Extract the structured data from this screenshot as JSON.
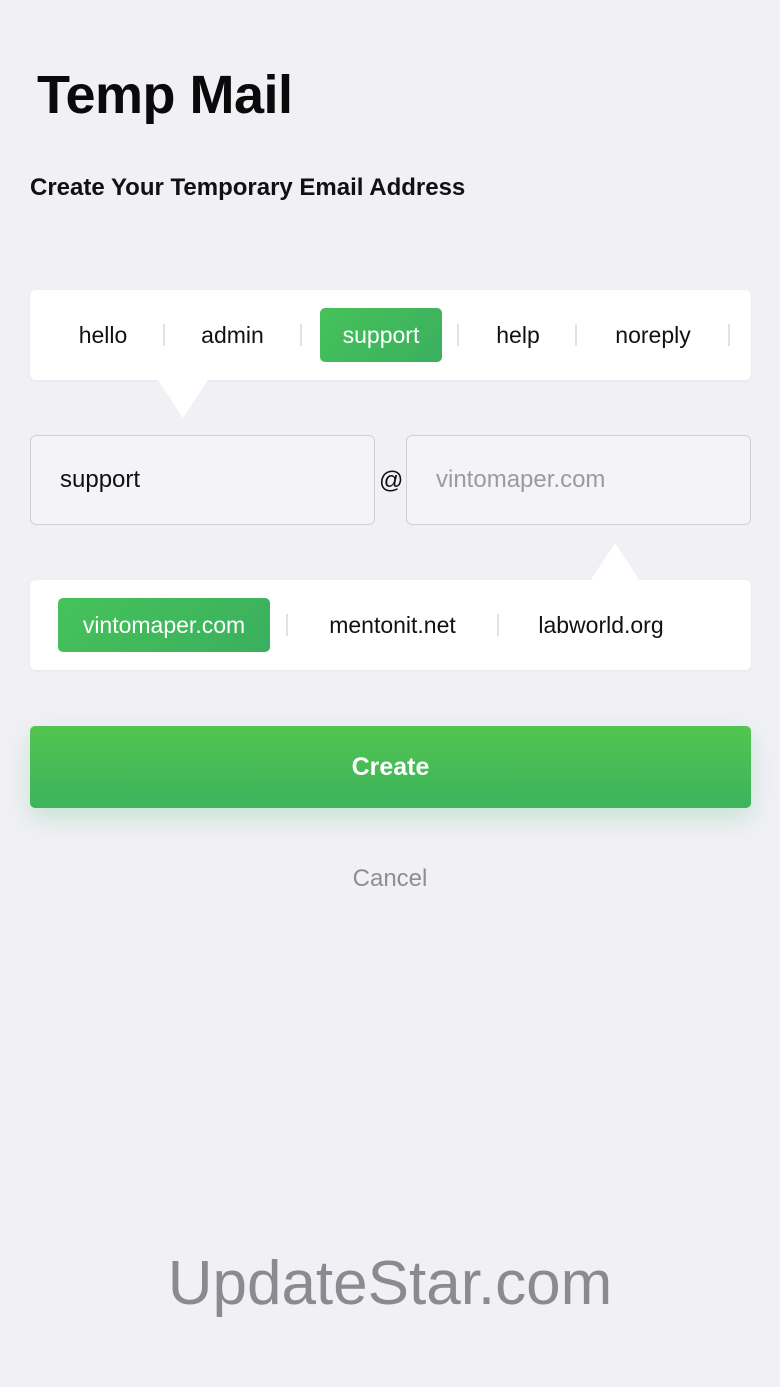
{
  "app": {
    "title": "Temp Mail",
    "subtitle": "Create Your Temporary Email Address"
  },
  "prefixes": {
    "items": [
      "hello",
      "admin",
      "support",
      "help",
      "noreply"
    ],
    "selected": "support"
  },
  "email": {
    "local_value": "support",
    "at_symbol": "@",
    "domain_placeholder": "vintomaper.com"
  },
  "domains": {
    "items": [
      "vintomaper.com",
      "mentonit.net",
      "labworld.org"
    ],
    "selected": "vintomaper.com"
  },
  "actions": {
    "create_label": "Create",
    "cancel_label": "Cancel"
  },
  "watermark": "UpdateStar.com",
  "colors": {
    "accent": "#46c25a",
    "background": "#f0f0f5",
    "muted_text": "#8e8e93"
  }
}
